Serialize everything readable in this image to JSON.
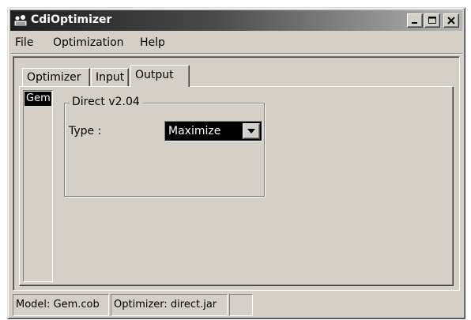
{
  "window": {
    "title": "CdiOptimizer",
    "app_icon": "cdi-optimizer-app-icon",
    "controls": [
      "minimize-icon",
      "maximize-icon",
      "close-icon"
    ]
  },
  "menu": {
    "file": "File",
    "optimization": "Optimization",
    "help": "Help"
  },
  "tabs": {
    "optimizer": "Optimizer",
    "input": "Input",
    "output": "Output",
    "active": "Output"
  },
  "side_list": {
    "items": [
      "Gem"
    ],
    "selected": "Gem"
  },
  "group": {
    "title": "Direct v2.04",
    "type_label": "Type :",
    "type_value": "Maximize",
    "dropdown_icon": "chevron-down-icon"
  },
  "status": {
    "model": "Model: Gem.cob",
    "optimizer": "Optimizer: direct.jar",
    "extra": ""
  },
  "colors": {
    "face": "#d4d0c8",
    "titlebar_start": "#1f1f1f",
    "titlebar_end": "#b5b5b5",
    "selection": "#000000",
    "selection_text": "#ffffff"
  }
}
